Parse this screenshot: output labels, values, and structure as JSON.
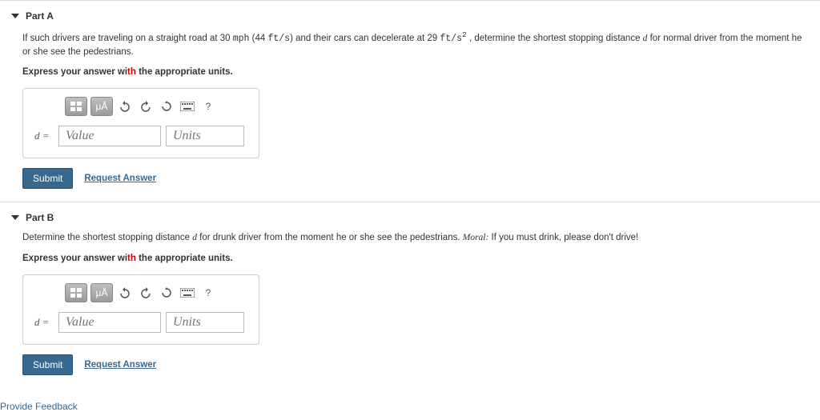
{
  "partA": {
    "title": "Part A",
    "question_pre": "If such drivers are traveling on a straight road at 30 ",
    "q_unit1": "mph",
    "q_mid1": " (44 ",
    "q_unit2": "ft/s",
    "q_mid2": ") and their cars can decelerate at 29 ",
    "q_unit3": "ft/s",
    "q_sup": "2",
    "q_mid3": " , determine the shortest stopping distance ",
    "q_var": "d",
    "q_post": " for normal driver from the moment he or she see the pedestrians.",
    "instruction_pre": "Express your answer wi",
    "instruction_th": "th",
    "instruction_post": " the appropriate units.",
    "var_label": "d =",
    "value_placeholder": "Value",
    "units_placeholder": "Units",
    "submit": "Submit",
    "request": "Request Answer",
    "mu_label": "μÅ",
    "help_label": "?"
  },
  "partB": {
    "title": "Part B",
    "question_pre": "Determine the shortest stopping distance ",
    "q_var": "d",
    "q_mid": " for drunk driver from the moment he or she see the pedestrians. ",
    "q_moral_label": "Moral:",
    "q_moral": " If you must drink, please don't drive!",
    "instruction_pre": "Express your answer wi",
    "instruction_th": "th",
    "instruction_post": " the appropriate units.",
    "var_label": "d =",
    "value_placeholder": "Value",
    "units_placeholder": "Units",
    "submit": "Submit",
    "request": "Request Answer",
    "mu_label": "μÅ",
    "help_label": "?"
  },
  "feedback": "Provide Feedback"
}
